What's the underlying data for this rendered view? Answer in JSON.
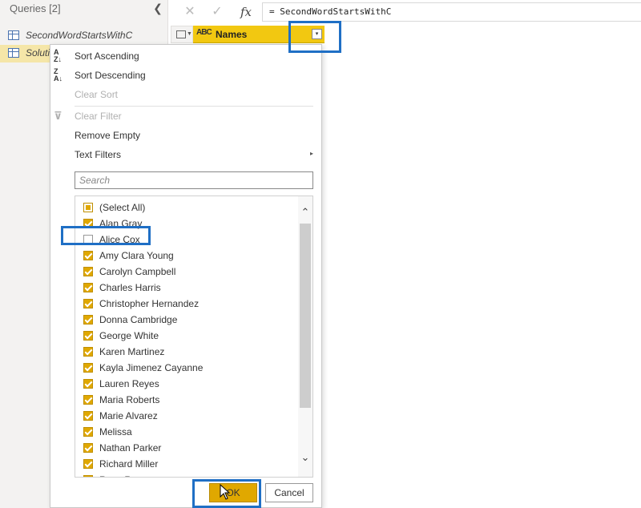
{
  "queries_pane": {
    "title": "Queries [2]",
    "collapse_glyph": "❮",
    "items": [
      {
        "label": "SecondWordStartsWithC",
        "icon": "table-icon",
        "selected": false
      },
      {
        "label": "Soluti",
        "icon": "table-icon",
        "selected": true
      }
    ]
  },
  "formula_bar": {
    "cancel_glyph": "✕",
    "confirm_glyph": "✓",
    "fx_glyph": "fx",
    "formula": "= SecondWordStartsWithC"
  },
  "column": {
    "type_icon": "ABC",
    "name": "Names",
    "dropdown_glyph": "▾"
  },
  "filter_menu": {
    "sort_ascending": "Sort Ascending",
    "sort_descending": "Sort Descending",
    "clear_sort": "Clear Sort",
    "clear_filter": "Clear Filter",
    "remove_empty": "Remove Empty",
    "text_filters": "Text Filters",
    "submenu_glyph": "▸",
    "search_placeholder": "Search",
    "items": [
      {
        "label": "(Select All)",
        "state": "partial"
      },
      {
        "label": "Alan Gray",
        "state": "checked"
      },
      {
        "label": "Alice Cox",
        "state": "unchecked"
      },
      {
        "label": "Amy Clara Young",
        "state": "checked"
      },
      {
        "label": "Carolyn Campbell",
        "state": "checked"
      },
      {
        "label": "Charles Harris",
        "state": "checked"
      },
      {
        "label": "Christopher Hernandez",
        "state": "checked"
      },
      {
        "label": "Donna Cambridge",
        "state": "checked"
      },
      {
        "label": "George White",
        "state": "checked"
      },
      {
        "label": "Karen Martinez",
        "state": "checked"
      },
      {
        "label": "Kayla Jimenez Cayanne",
        "state": "checked"
      },
      {
        "label": "Lauren Reyes",
        "state": "checked"
      },
      {
        "label": "Maria Roberts",
        "state": "checked"
      },
      {
        "label": "Marie Alvarez",
        "state": "checked"
      },
      {
        "label": "Melissa",
        "state": "checked"
      },
      {
        "label": "Nathan Parker",
        "state": "checked"
      },
      {
        "label": "Richard Miller",
        "state": "checked"
      },
      {
        "label": "Rosa Rosa",
        "state": "checked"
      }
    ],
    "scroll_up_glyph": "⌃",
    "scroll_down_glyph": "⌄",
    "ok_label": "OK",
    "cancel_label": "Cancel"
  },
  "colors": {
    "accent_yellow": "#f2c811",
    "checkbox_fill": "#e0a800",
    "highlight_blue": "#1f6fc5"
  }
}
